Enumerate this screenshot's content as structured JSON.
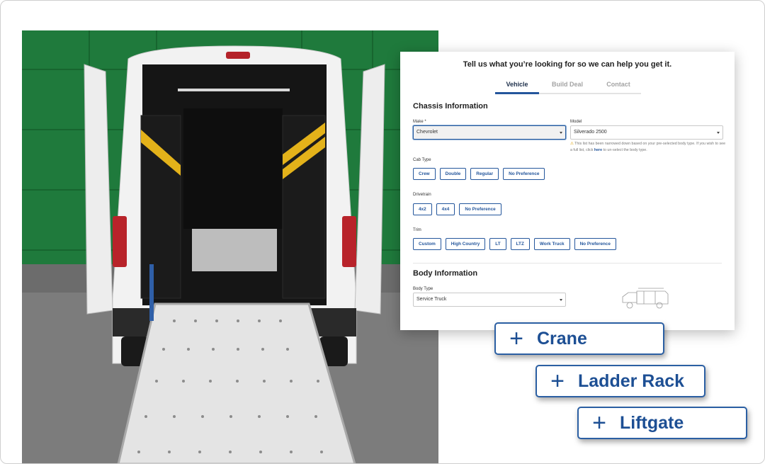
{
  "form": {
    "header": "Tell us what you’re looking for so we can help you get it.",
    "tabs": [
      {
        "label": "Vehicle",
        "active": true
      },
      {
        "label": "Build Deal",
        "active": false
      },
      {
        "label": "Contact",
        "active": false
      }
    ],
    "chassis": {
      "title": "Chassis Information",
      "make_label": "Make *",
      "make_value": "Chevrolet",
      "model_label": "Model",
      "model_value": "Silverado 2500",
      "note_prefix": "This list has been narrowed down based on your pre-selected body type. If you wish to see a full list, click ",
      "note_link": "here",
      "note_suffix": " to un-select the body type.",
      "cab_type_label": "Cab Type",
      "cab_types": [
        "Crew",
        "Double",
        "Regular",
        "No Preference"
      ],
      "drivetrain_label": "Drivetrain",
      "drivetrains": [
        "4x2",
        "4x4",
        "No Preference"
      ],
      "trim_label": "Trim",
      "trims": [
        "Custom",
        "High Country",
        "LT",
        "LTZ",
        "Work Truck",
        "No Preference"
      ]
    },
    "body": {
      "title": "Body Information",
      "body_type_label": "Body Type",
      "body_type_value": "Service Truck"
    }
  },
  "addons": [
    {
      "symbol": "+",
      "label": "Crane"
    },
    {
      "symbol": "+",
      "label": "Ladder Rack"
    },
    {
      "symbol": "+",
      "label": "Liftgate"
    }
  ],
  "colors": {
    "accent": "#24569c",
    "wall_green": "#1f7a3c",
    "shelf_yellow": "#e3b21a"
  }
}
